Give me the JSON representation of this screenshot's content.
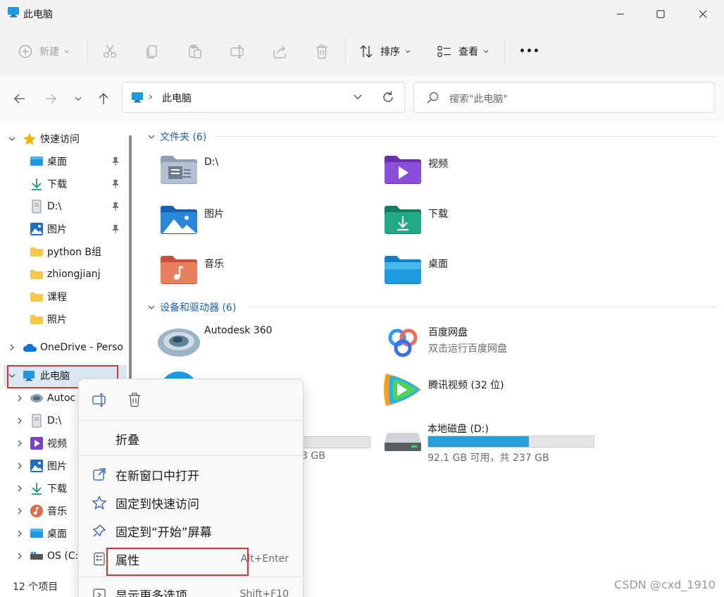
{
  "window": {
    "title": "此电脑"
  },
  "toolbar": {
    "new_label": "新建",
    "sort_label": "排序",
    "view_label": "查看",
    "more_label": "•••"
  },
  "address": {
    "location": "此电脑",
    "chevron": "›"
  },
  "search": {
    "placeholder": "搜索\"此电脑\""
  },
  "sidebar": {
    "quick_access": "快速访问",
    "quick_items": [
      {
        "label": "桌面",
        "icon": "desktop-icon"
      },
      {
        "label": "下载",
        "icon": "download-icon"
      },
      {
        "label": "D:\\",
        "icon": "drive-icon"
      },
      {
        "label": "图片",
        "icon": "pictures-icon"
      },
      {
        "label": "python B组",
        "icon": "folder-icon"
      },
      {
        "label": "zhiongjianj",
        "icon": "folder-icon"
      },
      {
        "label": "课程",
        "icon": "folder-icon"
      },
      {
        "label": "照片",
        "icon": "folder-icon"
      }
    ],
    "onedrive": "OneDrive - Perso",
    "this_pc": "此电脑",
    "pc_items": [
      {
        "label": "Autoc",
        "icon": "autodesk-icon"
      },
      {
        "label": "D:\\",
        "icon": "drive-icon"
      },
      {
        "label": "视频",
        "icon": "video-icon"
      },
      {
        "label": "图片",
        "icon": "pictures-icon"
      },
      {
        "label": "下载",
        "icon": "download-icon"
      },
      {
        "label": "音乐",
        "icon": "music-icon"
      },
      {
        "label": "桌面",
        "icon": "desktop-icon"
      },
      {
        "label": "OS (C:",
        "icon": "os-drive-icon"
      }
    ]
  },
  "main": {
    "folders_header": "文件夹 (6)",
    "folders": [
      {
        "label": "D:\\",
        "icon": "drive-folder-icon"
      },
      {
        "label": "视频",
        "icon": "video-folder-icon"
      },
      {
        "label": "图片",
        "icon": "pictures-folder-icon"
      },
      {
        "label": "下载",
        "icon": "download-folder-icon"
      },
      {
        "label": "音乐",
        "icon": "music-folder-icon"
      },
      {
        "label": "桌面",
        "icon": "desktop-folder-icon"
      }
    ],
    "devices_header": "设备和驱动器 (6)",
    "devices": {
      "autodesk": {
        "label": "Autodesk 360"
      },
      "baidu": {
        "label": "百度网盘",
        "sub": "双击运行百度网盘"
      },
      "tencent": {
        "label": "腾讯视频 (32 位)"
      },
      "local_d": {
        "label": "本地磁盘 (D:)",
        "free": "92.1 GB 可用，共 237 GB",
        "used_fraction": 0.61
      },
      "partial_c": {
        "free_tail": "3 GB",
        "used_fraction": 0.2
      }
    }
  },
  "status": {
    "count": "12 个项目"
  },
  "context_menu": {
    "collapse": "折叠",
    "open_new_window": "在新窗口中打开",
    "pin_quick": "固定到快速访问",
    "pin_start": "固定到“开始”屏幕",
    "properties": "属性",
    "properties_shortcut": "Alt+Enter",
    "more_options": "显示更多选项",
    "more_options_shortcut": "Shift+F10"
  },
  "watermark": "CSDN @cxd_1910",
  "colors": {
    "accent": "#1a5fb4",
    "progress": "#26a0da",
    "highlight_box": "#e0302b"
  }
}
